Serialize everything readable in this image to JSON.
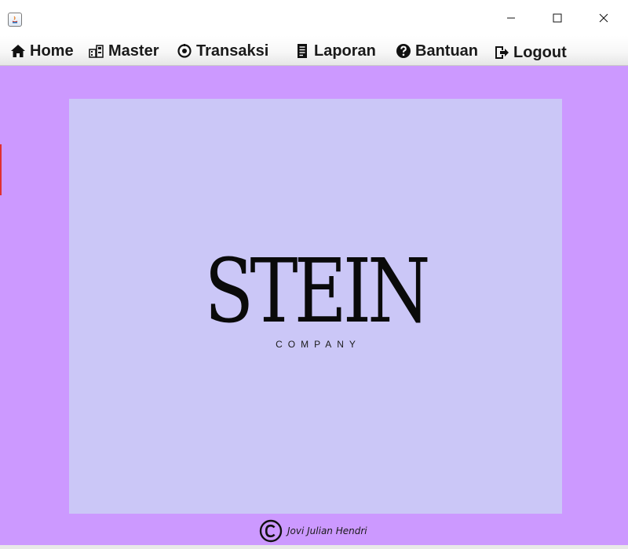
{
  "window": {
    "title": "",
    "controls": {
      "minimize": "minimize-icon",
      "maximize": "maximize-icon",
      "close": "close-icon"
    }
  },
  "menu": {
    "items": [
      {
        "label": "Home",
        "icon": "home-icon"
      },
      {
        "label": "Master",
        "icon": "master-icon"
      },
      {
        "label": "Transaksi",
        "icon": "transaction-icon"
      },
      {
        "label": "Laporan",
        "icon": "report-icon"
      },
      {
        "label": "Bantuan",
        "icon": "help-icon"
      },
      {
        "label": "Logout",
        "icon": "logout-icon"
      }
    ]
  },
  "main": {
    "logo_title": "STEIN",
    "logo_subtitle": "COMPANY"
  },
  "footer": {
    "copyright_symbol": "©",
    "author": "Jovi Julian Hendri"
  },
  "colors": {
    "background": "#cc99ff",
    "panel": "#cbc7f7",
    "text": "#0a0a0a"
  }
}
